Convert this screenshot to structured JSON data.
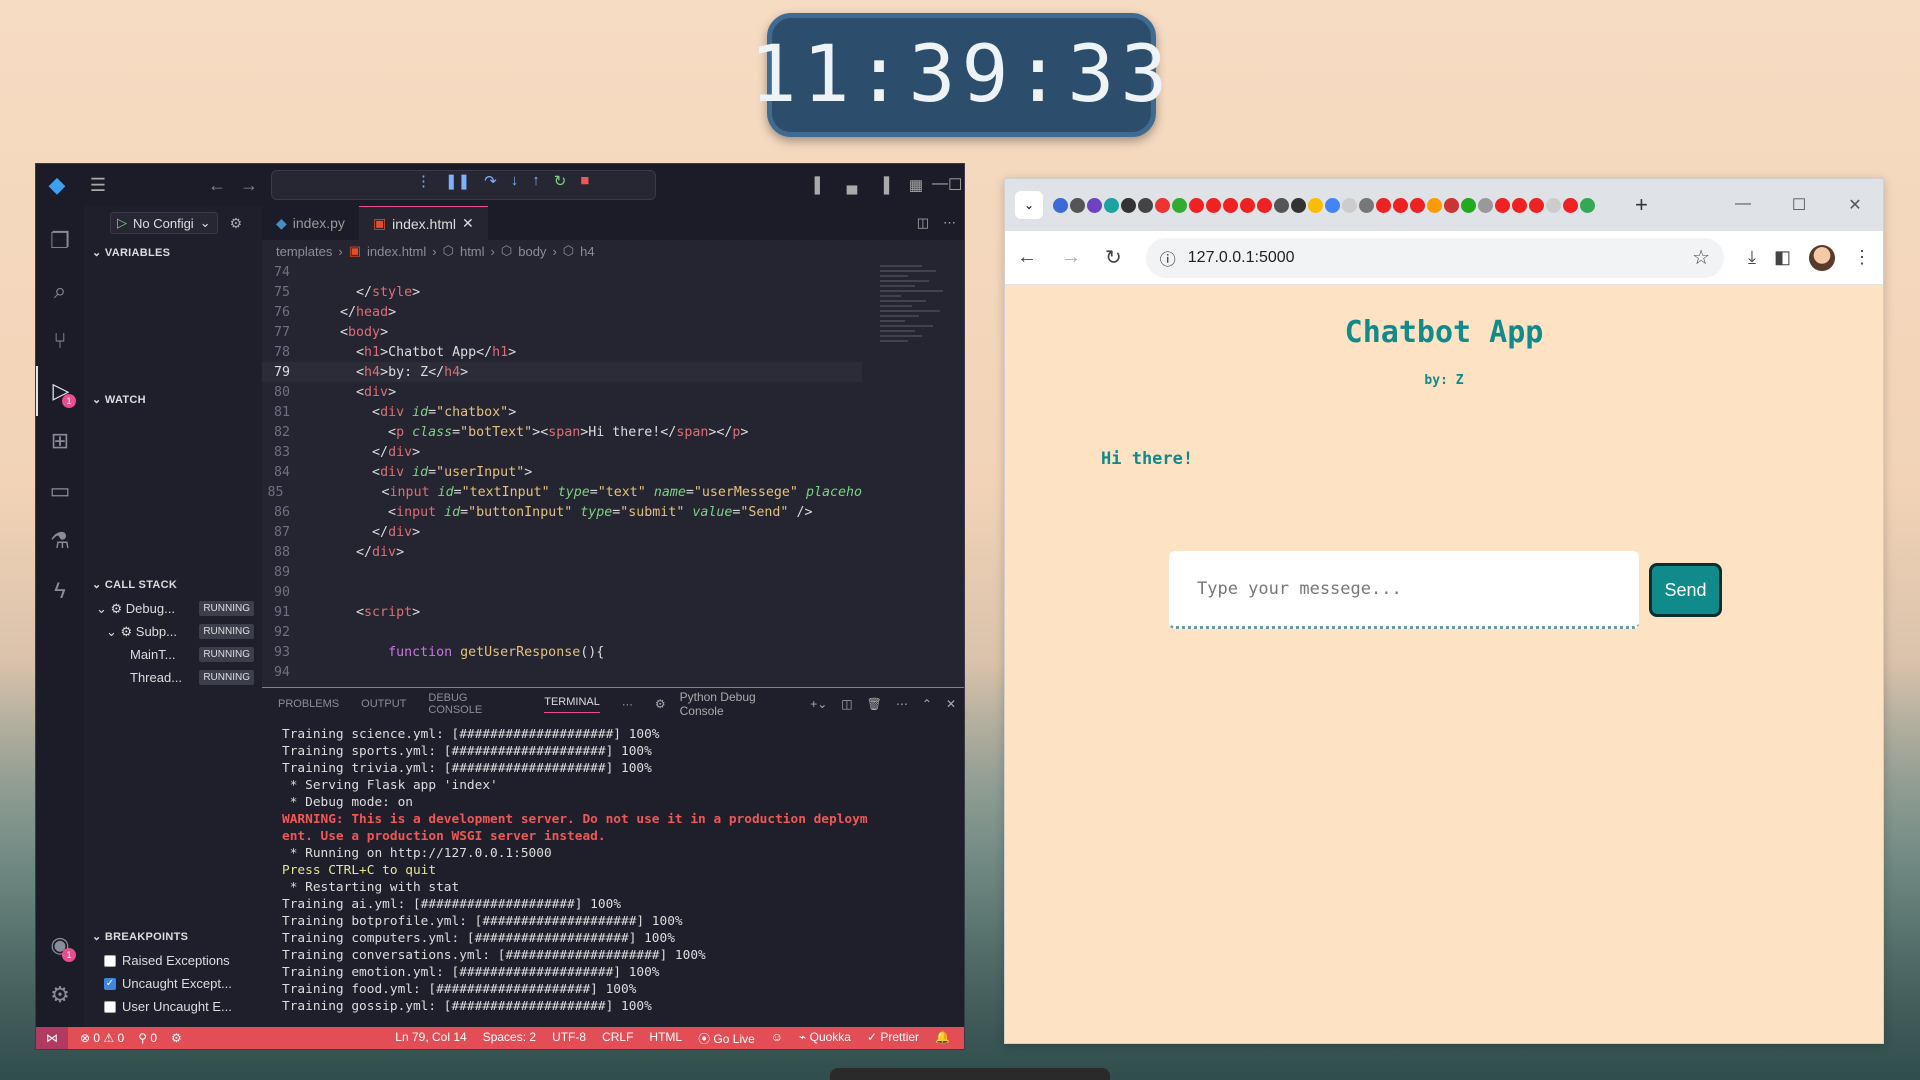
{
  "clock": {
    "time": "11:39:33"
  },
  "vscode": {
    "debug_config": "No Configi",
    "tabs": [
      {
        "label": "index.py"
      },
      {
        "label": "index.html"
      }
    ],
    "breadcrumb": [
      "templates",
      "index.html",
      "html",
      "body",
      "h4"
    ],
    "sections": {
      "variables": "VARIABLES",
      "watch": "WATCH",
      "call_stack": "CALL STACK",
      "breakpoints": "BREAKPOINTS"
    },
    "call_stack": [
      {
        "name": "Debug...",
        "status": "RUNNING"
      },
      {
        "name": "Subp...",
        "status": "RUNNING"
      },
      {
        "name": "MainT...",
        "status": "RUNNING"
      },
      {
        "name": "Thread...",
        "status": "RUNNING"
      }
    ],
    "breakpoints": [
      {
        "label": "Raised Exceptions",
        "checked": false
      },
      {
        "label": "Uncaught Except...",
        "checked": true
      },
      {
        "label": "User Uncaught E...",
        "checked": false
      }
    ],
    "panel_tabs": [
      "PROBLEMS",
      "OUTPUT",
      "DEBUG CONSOLE",
      "TERMINAL"
    ],
    "terminal_name": "Python Debug Console",
    "status": {
      "errors": "0",
      "warnings": "0",
      "ports": "0",
      "position": "Ln 79, Col 14",
      "spaces": "Spaces: 2",
      "encoding": "UTF-8",
      "eol": "CRLF",
      "language": "HTML",
      "golive": "Go Live",
      "quokka": "Quokka",
      "prettier": "Prettier"
    }
  },
  "browser": {
    "url": "127.0.0.1:5000",
    "page": {
      "title": "Chatbot App",
      "subtitle": "by: Z",
      "bot_message": "Hi there!",
      "input_placeholder": "Type your messege...",
      "send_label": "Send"
    }
  }
}
